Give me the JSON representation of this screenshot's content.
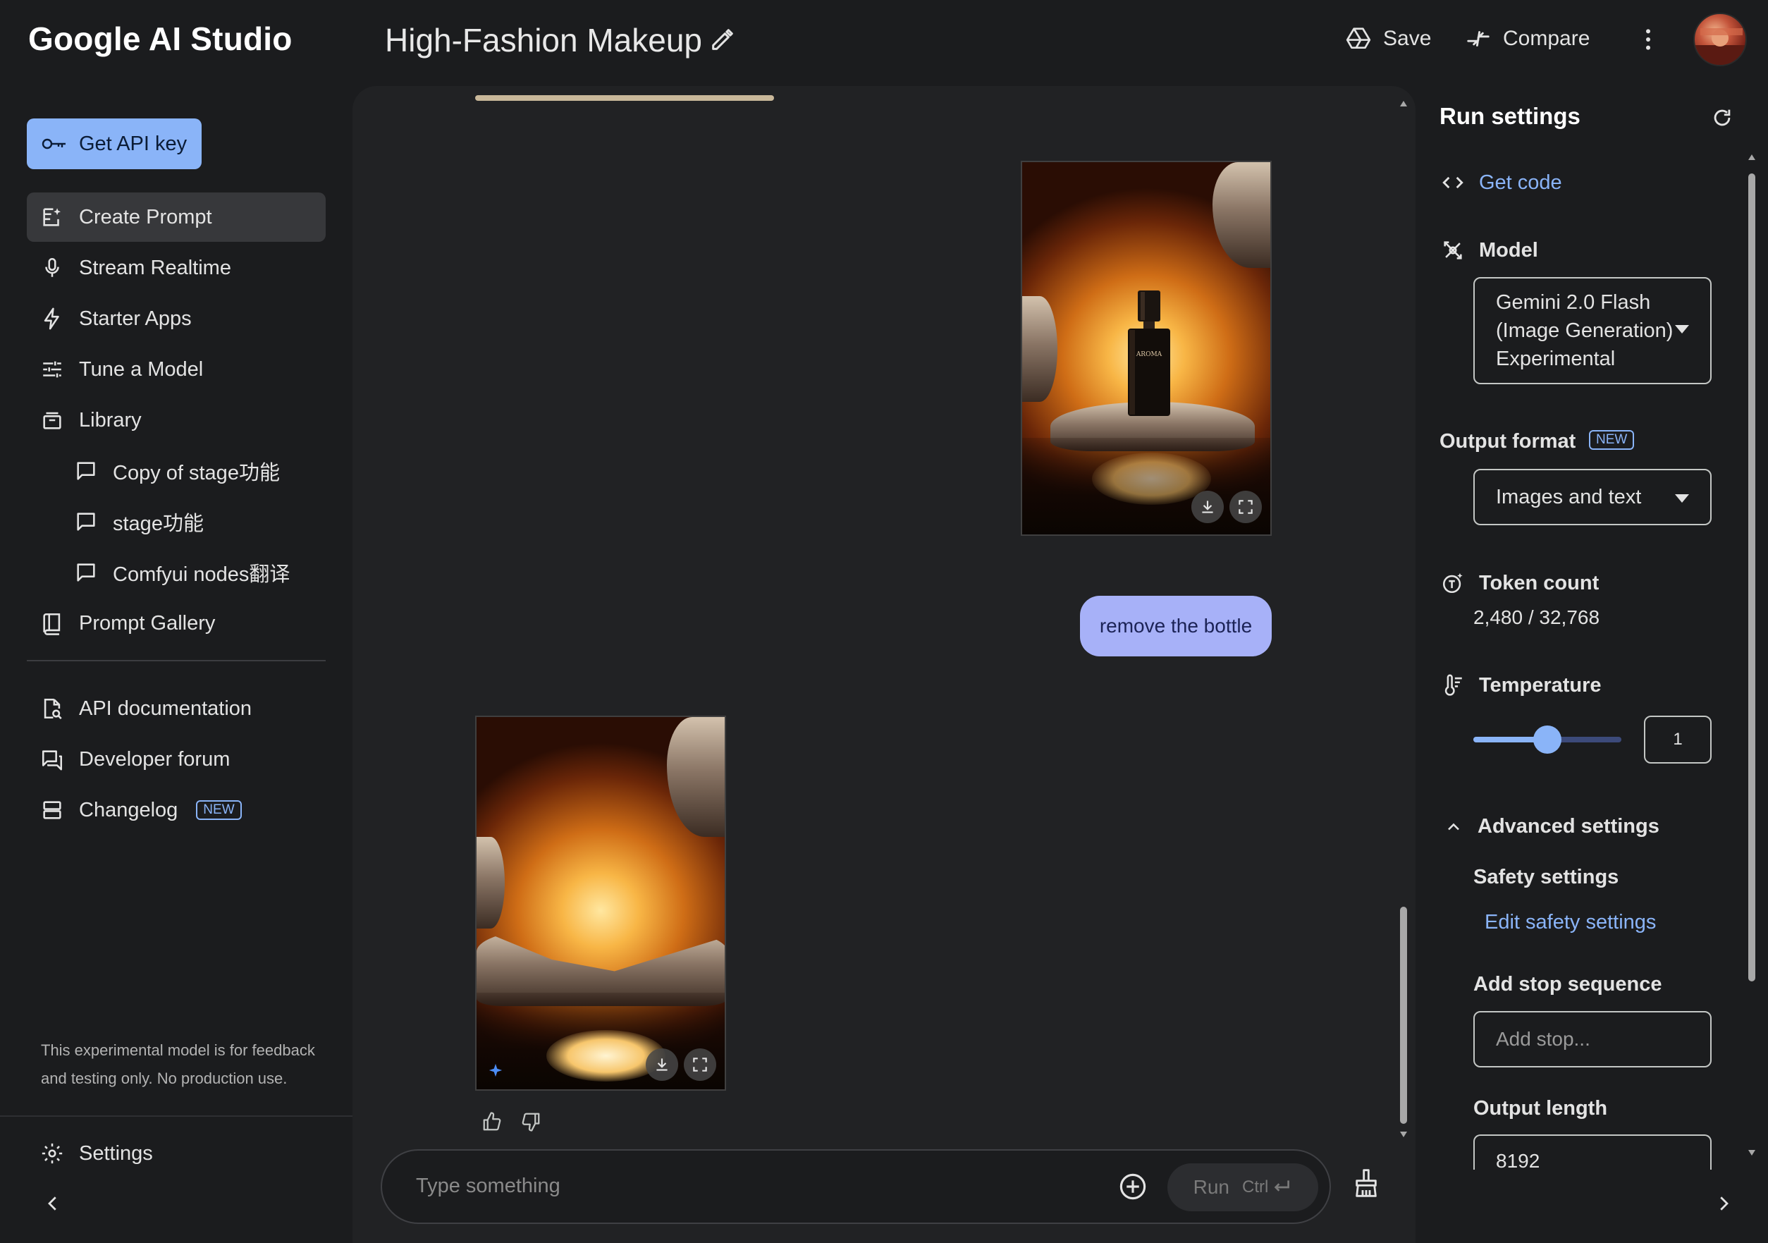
{
  "header": {
    "app_title": "Google AI Studio",
    "prompt_title": "High-Fashion Makeup",
    "save_label": "Save",
    "compare_label": "Compare"
  },
  "sidebar": {
    "api_key_label": "Get API key",
    "items": [
      {
        "label": "Create Prompt",
        "icon": "create-prompt-icon",
        "active": true
      },
      {
        "label": "Stream Realtime",
        "icon": "mic-icon"
      },
      {
        "label": "Starter Apps",
        "icon": "bolt-icon"
      },
      {
        "label": "Tune a Model",
        "icon": "tune-icon"
      },
      {
        "label": "Library",
        "icon": "library-icon"
      }
    ],
    "library_items": [
      {
        "label": "Copy of stage功能"
      },
      {
        "label": "stage功能"
      },
      {
        "label": "Comfyui nodes翻译"
      }
    ],
    "prompt_gallery_label": "Prompt Gallery",
    "resources": [
      {
        "label": "API documentation"
      },
      {
        "label": "Developer forum"
      },
      {
        "label": "Changelog",
        "badge": "NEW"
      }
    ],
    "disclaimer": "This experimental model is for feedback and testing only. No production use.",
    "settings_label": "Settings"
  },
  "chat": {
    "image_1_bottle_text": "AROMA",
    "user_message": "remove the bottle",
    "input_placeholder": "Type something",
    "run_label": "Run",
    "run_shortcut": "Ctrl"
  },
  "run_settings": {
    "title": "Run settings",
    "get_code_label": "Get code",
    "model_label": "Model",
    "model_value_lines": [
      "Gemini 2.0 Flash",
      "(Image Generation)",
      "Experimental"
    ],
    "output_format_label": "Output format",
    "output_format_badge": "NEW",
    "output_format_value": "Images and text",
    "token_count_label": "Token count",
    "token_count_value": "2,480 / 32,768",
    "temperature_label": "Temperature",
    "temperature_value": "1",
    "temperature_fraction": 0.5,
    "advanced_label": "Advanced settings",
    "safety_label": "Safety settings",
    "edit_safety_label": "Edit safety settings",
    "stop_sequence_label": "Add stop sequence",
    "stop_sequence_placeholder": "Add stop...",
    "output_length_label": "Output length",
    "output_length_value": "8192"
  },
  "colors": {
    "accent": "#8ab4f8",
    "user_bubble": "#a7b1f8",
    "background": "#1b1c1e",
    "chat_panel": "#212224"
  }
}
